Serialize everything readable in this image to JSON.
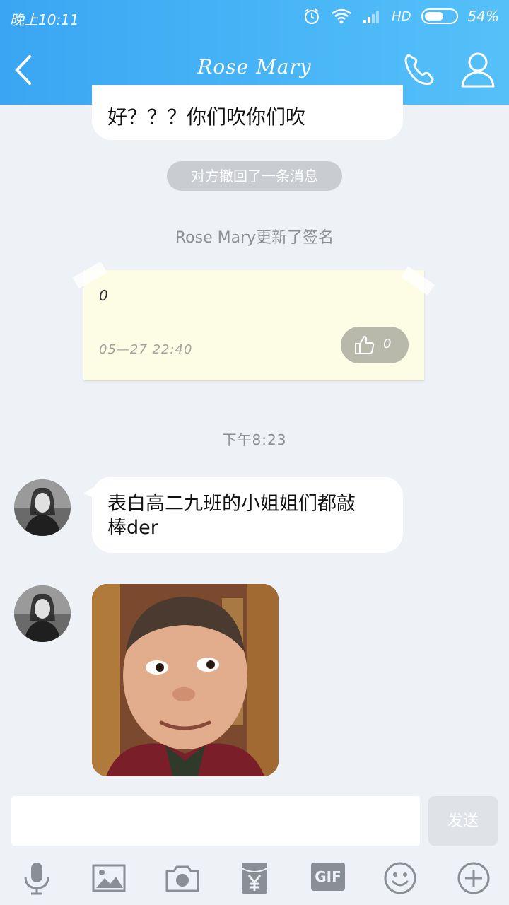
{
  "status_bar": {
    "time": "晚上10:11",
    "network_label": "HD",
    "battery_percent": "54%",
    "battery_level": 0.54
  },
  "header": {
    "contact_name": "Rose  Mary",
    "icons": [
      "back-icon",
      "phone-icon",
      "user-profile-icon"
    ]
  },
  "chat": {
    "partial_message": "好？？？你们吹你们吹",
    "recall_notice": "对方撤回了一条消息",
    "signature_update": "Rose  Mary更新了签名",
    "signature_note": {
      "content": "0",
      "date": "05—27  22:40",
      "like_count": "0"
    },
    "time_divider": "下午8:23",
    "message": "表白高二九班的小姐姐们都敲棒der"
  },
  "composer": {
    "input_value": "",
    "send_label": "发送"
  },
  "toolbar": {
    "gif_label": "GIF",
    "icons": [
      "microphone-icon",
      "image-icon",
      "camera-icon",
      "red-packet-icon",
      "gif-icon",
      "emoji-icon",
      "plus-icon"
    ]
  },
  "colors": {
    "header_blue": "#3aa6f3",
    "background": "#eef1f5",
    "note_yellow": "#fdfde6"
  }
}
